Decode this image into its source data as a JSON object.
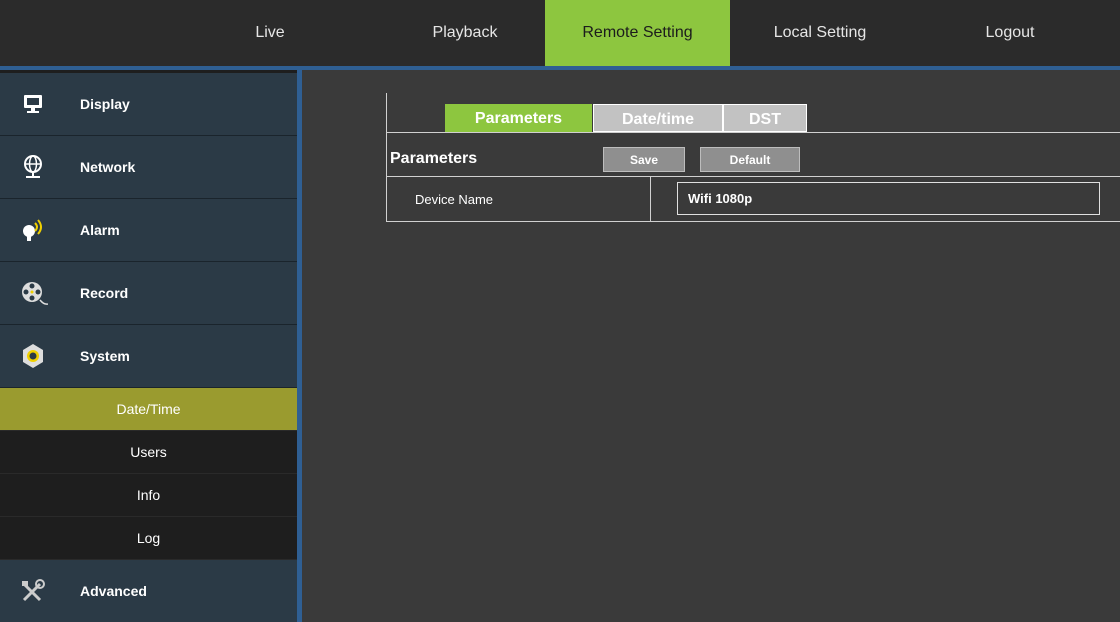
{
  "topnav": {
    "items": [
      {
        "label": "Live"
      },
      {
        "label": "Playback"
      },
      {
        "label": "Remote Setting",
        "active": true
      },
      {
        "label": "Local Setting"
      },
      {
        "label": "Logout"
      }
    ]
  },
  "sidebar": {
    "items": [
      {
        "label": "Display",
        "icon": "monitor-icon"
      },
      {
        "label": "Network",
        "icon": "globe-network-icon"
      },
      {
        "label": "Alarm",
        "icon": "alarm-bulb-icon"
      },
      {
        "label": "Record",
        "icon": "film-reel-icon"
      },
      {
        "label": "System",
        "icon": "gear-nut-icon"
      }
    ],
    "submenu": [
      {
        "label": "Date/Time",
        "active": true
      },
      {
        "label": "Users"
      },
      {
        "label": "Info"
      },
      {
        "label": "Log"
      }
    ],
    "advanced": {
      "label": "Advanced",
      "icon": "tools-icon"
    }
  },
  "tabs": [
    {
      "label": "Parameters",
      "active": true
    },
    {
      "label": "Date/time"
    },
    {
      "label": "DST"
    }
  ],
  "section": {
    "title": "Parameters",
    "save_label": "Save",
    "default_label": "Default"
  },
  "form": {
    "device_name_label": "Device Name",
    "device_name_value": "Wifi 1080p"
  },
  "colors": {
    "accent_green": "#8dc63f",
    "accent_blue": "#2f5f93",
    "submenu_active": "#9a9b2f"
  }
}
